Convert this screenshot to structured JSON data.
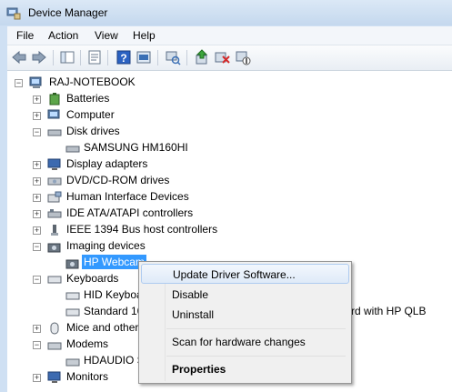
{
  "window": {
    "title": "Device Manager"
  },
  "menu": [
    "File",
    "Action",
    "View",
    "Help"
  ],
  "toolbar": {
    "buttons": [
      "back-arrow-icon",
      "forward-arrow-icon",
      "show-hide-tree-icon",
      "properties-icon",
      "help-icon",
      "scan-hardware-icon",
      "update-driver-icon",
      "uninstall-icon",
      "disable-icon"
    ]
  },
  "tree": {
    "root": "RAJ-NOTEBOOK",
    "items": [
      {
        "label": "Batteries"
      },
      {
        "label": "Computer"
      },
      {
        "label": "Disk drives"
      },
      {
        "label": "SAMSUNG HM160HI"
      },
      {
        "label": "Display adapters"
      },
      {
        "label": "DVD/CD-ROM drives"
      },
      {
        "label": "Human Interface Devices"
      },
      {
        "label": "IDE ATA/ATAPI controllers"
      },
      {
        "label": "IEEE 1394 Bus host controllers"
      },
      {
        "label": "Imaging devices"
      },
      {
        "label": "HP Webcam"
      },
      {
        "label": "Keyboards"
      },
      {
        "label": "HID Keyboa"
      },
      {
        "label": "Standard 10"
      },
      {
        "label": "rd with HP QLB"
      },
      {
        "label": "Mice and other"
      },
      {
        "label": "Modems"
      },
      {
        "label": "HDAUDIO S"
      },
      {
        "label": "Monitors"
      }
    ]
  },
  "context_menu": {
    "items": [
      "Update Driver Software...",
      "Disable",
      "Uninstall",
      "Scan for hardware changes",
      "Properties"
    ]
  }
}
